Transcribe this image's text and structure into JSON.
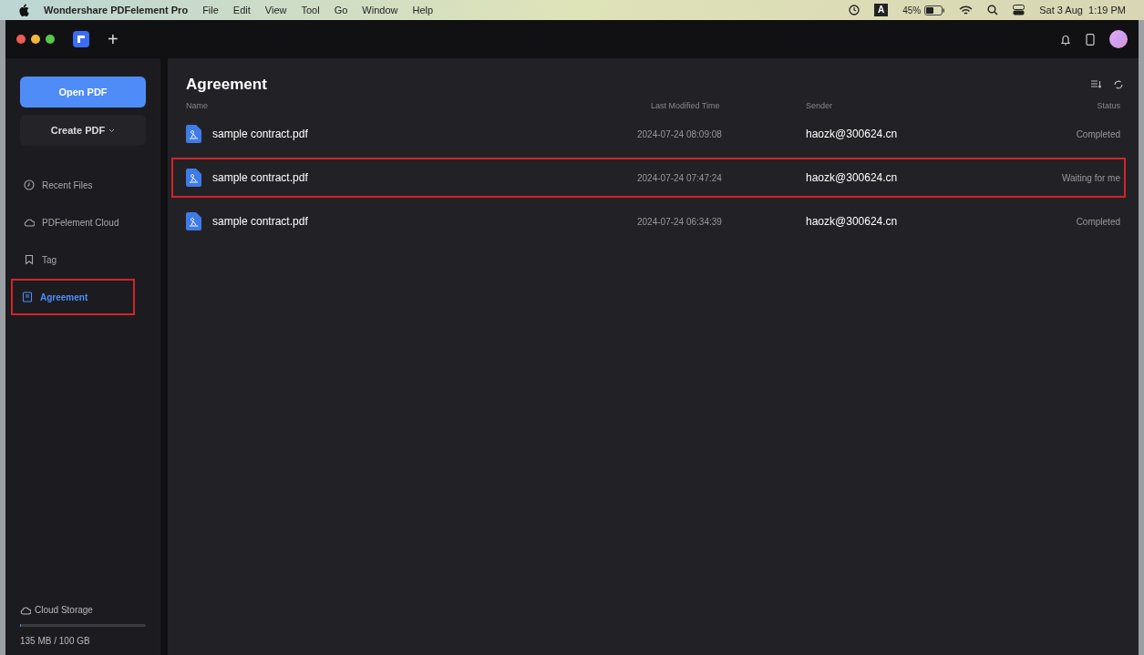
{
  "menu_bar": {
    "app_name": "Wondershare PDFelement Pro",
    "menus": [
      "File",
      "Edit",
      "View",
      "Tool",
      "Go",
      "Window",
      "Help"
    ],
    "battery": "45%",
    "clock": "Sat 3 Aug  1:19 PM",
    "input_source": "A"
  },
  "tab_bar": {
    "new_tab": "+"
  },
  "sidebar": {
    "open_button": "Open PDF",
    "create_button": "Create PDF",
    "items": [
      {
        "label": "Recent Files",
        "kind": "recent",
        "selected": false,
        "highlighted": false
      },
      {
        "label": "PDFelement Cloud",
        "kind": "cloud",
        "selected": false,
        "highlighted": false
      },
      {
        "label": "Tag",
        "kind": "tag",
        "selected": false,
        "highlighted": false
      },
      {
        "label": "Agreement",
        "kind": "agreement",
        "selected": true,
        "highlighted": true
      }
    ],
    "storage": {
      "label": "Cloud Storage",
      "usage": "135 MB / 100 GB",
      "level": 0.01
    }
  },
  "main": {
    "title": "Agreement",
    "columns": [
      "Name",
      "Last Modified Time",
      "Sender",
      "Status"
    ],
    "rows": [
      {
        "name": "sample contract.pdf",
        "time": "2024-07-24 08:09:08",
        "sender": "haozk@300624.cn",
        "status": "Completed",
        "highlighted": false
      },
      {
        "name": "sample contract.pdf",
        "time": "2024-07-24 07:47:24",
        "sender": "haozk@300624.cn",
        "status": "Waiting for me",
        "highlighted": true
      },
      {
        "name": "sample contract.pdf",
        "time": "2024-07-24 06:34:39",
        "sender": "haozk@300624.cn",
        "status": "Completed",
        "highlighted": false
      }
    ]
  }
}
